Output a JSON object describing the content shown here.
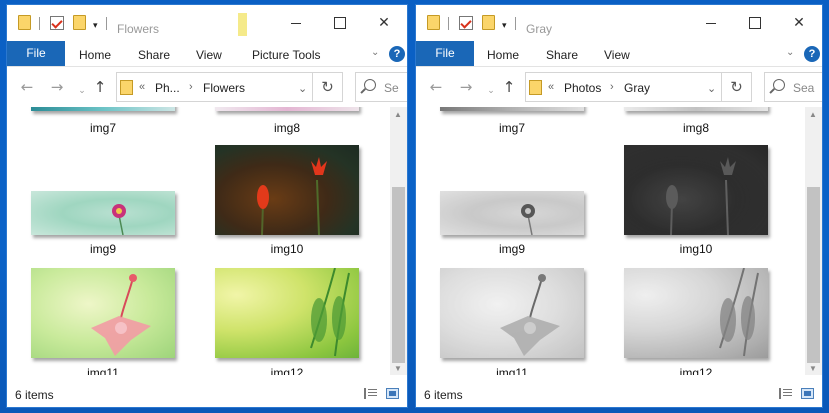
{
  "windows": [
    {
      "title": "Flowers",
      "contextual_tab": "Picture Tools",
      "ribbon": {
        "file": "File",
        "tabs": [
          "Home",
          "Share",
          "View"
        ]
      },
      "help": "?",
      "address": {
        "overflow": "«",
        "segments": [
          "Ph...",
          "Flowers"
        ]
      },
      "search_placeholder": "Se",
      "grayscale": false,
      "items": [
        {
          "name": "img7"
        },
        {
          "name": "img8"
        },
        {
          "name": "img9"
        },
        {
          "name": "img10"
        },
        {
          "name": "img11"
        },
        {
          "name": "img12"
        }
      ],
      "status": "6 items"
    },
    {
      "title": "Gray",
      "contextual_tab": "",
      "ribbon": {
        "file": "File",
        "tabs": [
          "Home",
          "Share",
          "View"
        ]
      },
      "help": "?",
      "address": {
        "overflow": "«",
        "segments": [
          "Photos",
          "Gray"
        ]
      },
      "search_placeholder": "Sea",
      "grayscale": true,
      "items": [
        {
          "name": "img7"
        },
        {
          "name": "img8"
        },
        {
          "name": "img9"
        },
        {
          "name": "img10"
        },
        {
          "name": "img11"
        },
        {
          "name": "img12"
        }
      ],
      "status": "6 items"
    }
  ],
  "icons": {
    "quick_access": [
      "folder-icon",
      "properties-icon",
      "new-folder-icon",
      "customize-quick-access-icon"
    ],
    "window_controls": [
      "minimize-icon",
      "maximize-icon",
      "close-icon"
    ],
    "navigation": [
      "back-icon",
      "forward-icon",
      "recent-locations-icon",
      "up-icon"
    ],
    "address_bar": [
      "folder-icon",
      "chevron-right-icon",
      "refresh-icon"
    ],
    "search": "search-icon",
    "views": [
      "details-view-icon",
      "large-icons-view-icon"
    ]
  }
}
